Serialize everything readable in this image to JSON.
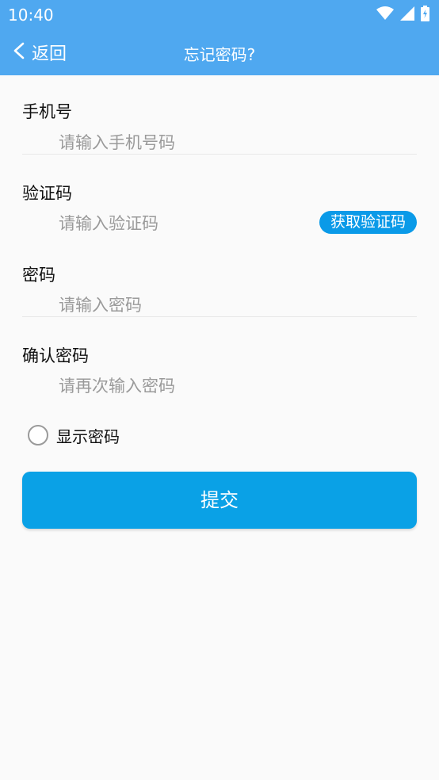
{
  "status_bar": {
    "time": "10:40",
    "icons": [
      "wifi-icon",
      "signal-icon",
      "battery-icon"
    ]
  },
  "title_bar": {
    "back_label": "返回",
    "title": "忘记密码?"
  },
  "form": {
    "phone": {
      "label": "手机号",
      "placeholder": "请输入手机号码"
    },
    "code": {
      "label": "验证码",
      "placeholder": "请输入验证码",
      "button": "获取验证码"
    },
    "password": {
      "label": "密码",
      "placeholder": "请输入密码"
    },
    "confirm": {
      "label": "确认密码",
      "placeholder": "请再次输入密码"
    },
    "show_password": "显示密码",
    "submit": "提交"
  },
  "colors": {
    "header": "#4fa8f0",
    "accent": "#0aa1e6",
    "background": "#fafafa"
  }
}
